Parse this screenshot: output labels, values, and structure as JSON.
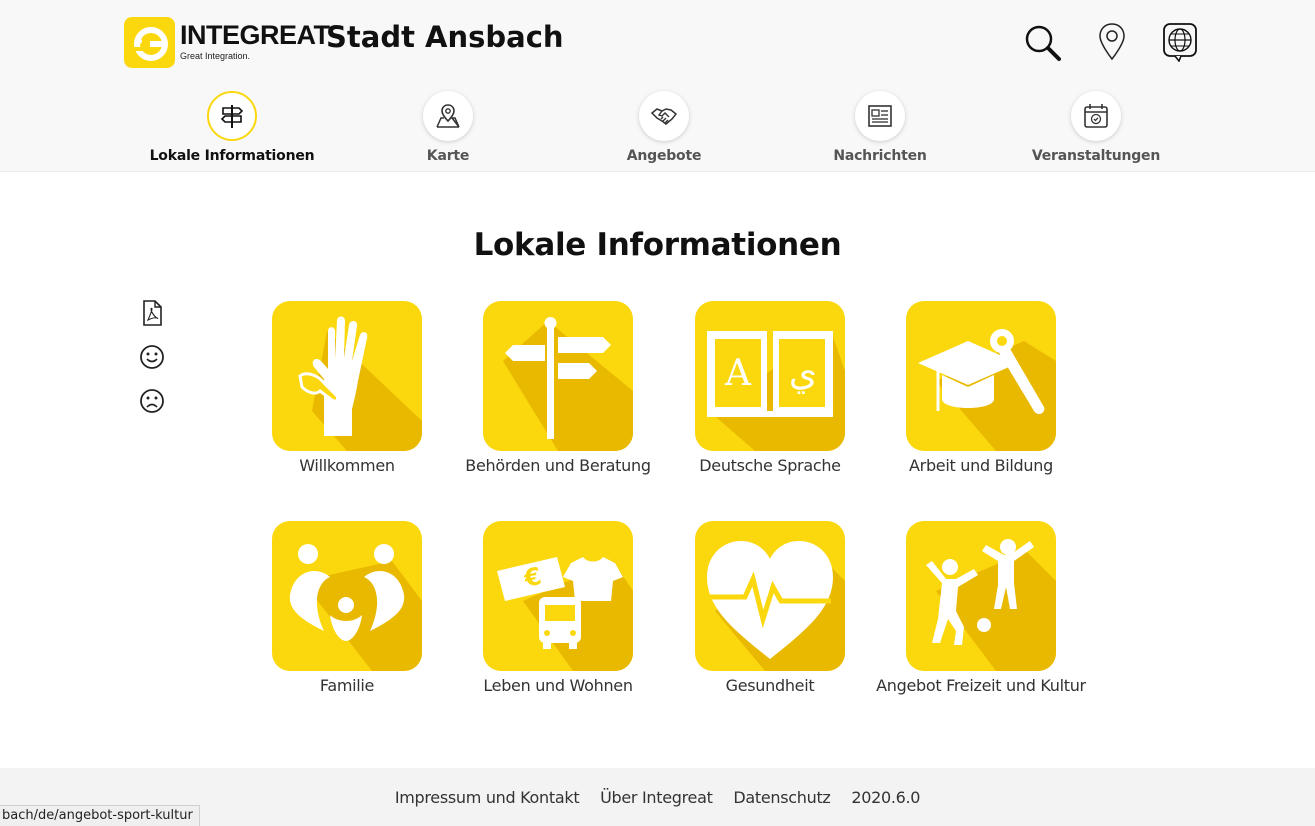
{
  "header": {
    "logo_word": "INTEGREAT",
    "logo_tagline": "Great Integration.",
    "city": "Stadt Ansbach",
    "icons": [
      "search-icon",
      "location-icon",
      "language-icon"
    ]
  },
  "nav": {
    "items": [
      {
        "label": "Lokale Informationen",
        "icon": "signpost-icon",
        "active": true
      },
      {
        "label": "Karte",
        "icon": "map-icon",
        "active": false
      },
      {
        "label": "Angebote",
        "icon": "handshake-icon",
        "active": false
      },
      {
        "label": "Nachrichten",
        "icon": "newspaper-icon",
        "active": false
      },
      {
        "label": "Veranstaltungen",
        "icon": "calendar-icon",
        "active": false
      }
    ]
  },
  "main": {
    "title": "Lokale Informationen",
    "side_tools": [
      "pdf-icon",
      "smiley-happy-icon",
      "smiley-sad-icon"
    ],
    "tiles": [
      {
        "label": "Willkommen",
        "icon": "hand-icon"
      },
      {
        "label": "Behörden und Beratung",
        "icon": "signpost-icon"
      },
      {
        "label": "Deutsche Sprache",
        "icon": "book-icon"
      },
      {
        "label": "Arbeit und Bildung",
        "icon": "graduation-tools-icon"
      },
      {
        "label": "Familie",
        "icon": "family-icon"
      },
      {
        "label": "Leben und Wohnen",
        "icon": "living-icon"
      },
      {
        "label": "Gesundheit",
        "icon": "heart-icon"
      },
      {
        "label": "Angebot Freizeit und Kultur",
        "icon": "leisure-icon"
      }
    ]
  },
  "footer": {
    "links": [
      "Impressum und Kontakt",
      "Über Integreat",
      "Datenschutz"
    ],
    "version": "2020.6.0"
  },
  "status_bar": {
    "url": "bach/de/angebot-sport-kultur"
  },
  "colors": {
    "brand_yellow": "#fbd80e",
    "tile_shadow": "#e9b900",
    "header_bg": "#f8f8f8"
  }
}
